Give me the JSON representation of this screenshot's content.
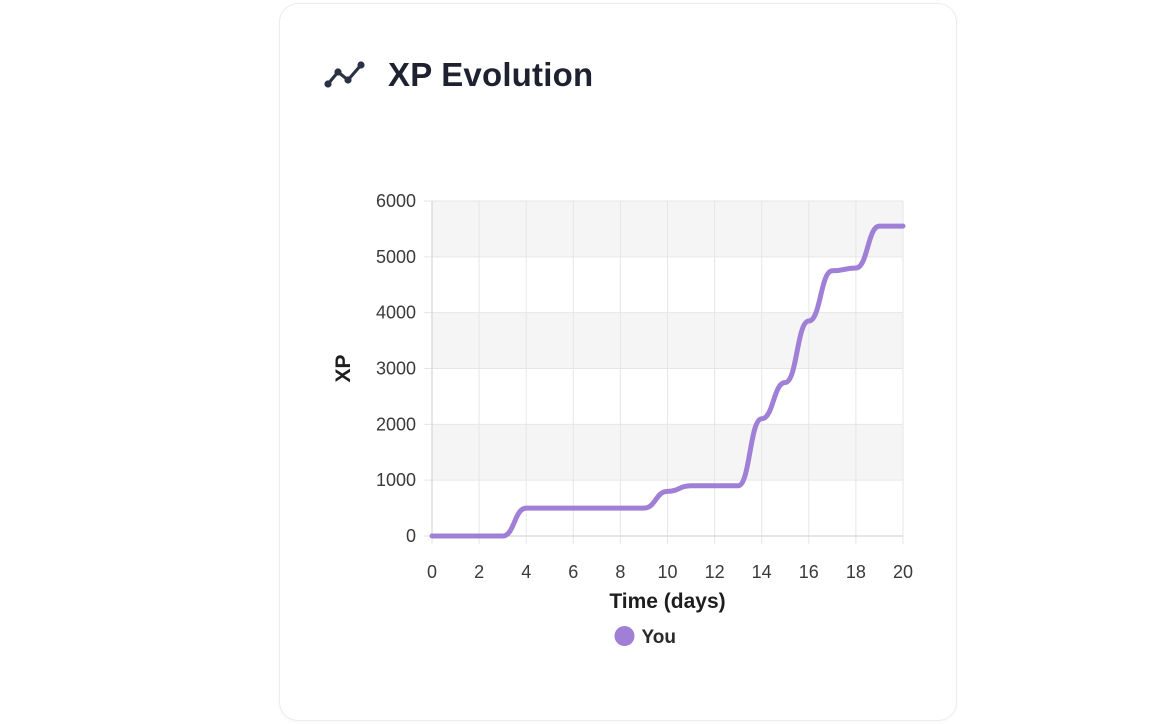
{
  "card": {
    "title": "XP Evolution",
    "icon": "line-chart-icon"
  },
  "chart_data": {
    "type": "line",
    "xlabel": "Time (days)",
    "ylabel": "XP",
    "xlim": [
      0,
      20
    ],
    "ylim": [
      0,
      6000
    ],
    "x_ticks": [
      "0",
      "2",
      "4",
      "6",
      "8",
      "10",
      "12",
      "14",
      "16",
      "18",
      "20"
    ],
    "y_ticks": [
      "0",
      "1000",
      "2000",
      "3000",
      "4000",
      "5000",
      "6000"
    ],
    "grid": true,
    "legend_position": "bottom",
    "series": [
      {
        "name": "You",
        "color": "#a07fd6",
        "x": [
          0,
          3,
          4,
          9,
          10,
          11,
          13,
          14,
          15,
          16,
          17,
          18,
          19,
          20
        ],
        "y": [
          0,
          0,
          500,
          500,
          800,
          900,
          900,
          2100,
          2750,
          3850,
          4750,
          4800,
          5550,
          5550
        ]
      }
    ]
  }
}
